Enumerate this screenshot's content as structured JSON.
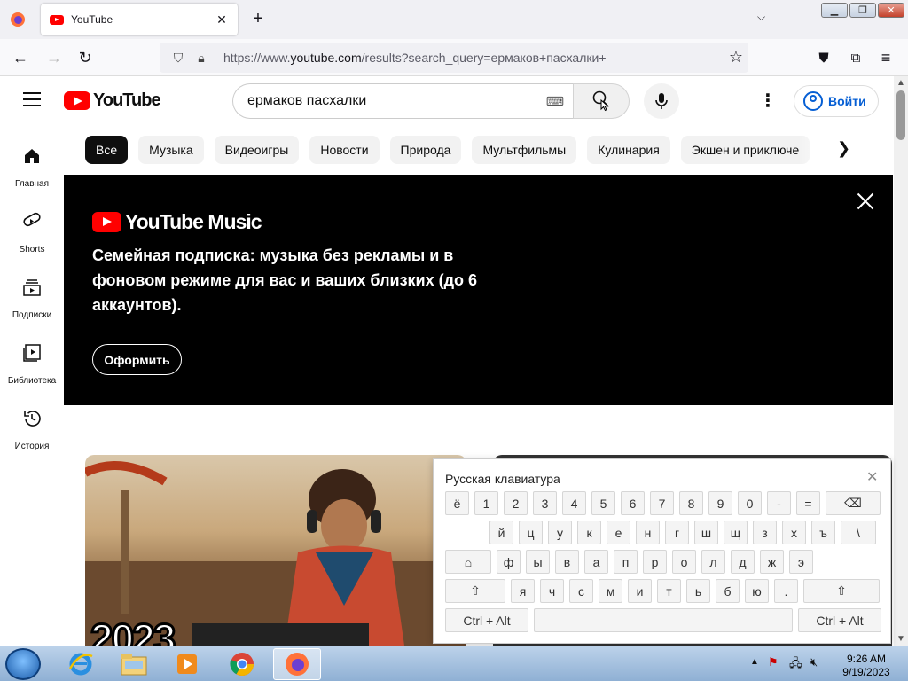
{
  "browser": {
    "tab_title": "YouTube",
    "new_tab": "+",
    "url_host": "https://www.",
    "url_domain": "youtube.com",
    "url_path": "/results?search_query=ермаков+пасхалки+"
  },
  "youtube": {
    "logo_text": "YouTube",
    "search_value": "ермаков пасхалки",
    "signin_label": "Войти",
    "chips": [
      "Все",
      "Музыка",
      "Видеоигры",
      "Новости",
      "Природа",
      "Мультфильмы",
      "Кулинария",
      "Экшен и приключе"
    ],
    "sidebar": [
      {
        "label": "Главная",
        "icon": "home-icon"
      },
      {
        "label": "Shorts",
        "icon": "shorts-icon"
      },
      {
        "label": "Подписки",
        "icon": "subscriptions-icon"
      },
      {
        "label": "Библиотека",
        "icon": "library-icon"
      },
      {
        "label": "История",
        "icon": "history-icon"
      }
    ],
    "banner": {
      "logo_text": "YouTube Music",
      "text": "Семейная подписка: музыка без рекламы и в фоновом режиме для вас и ваших близких (до 6 аккаунтов).",
      "button": "Оформить"
    },
    "thumbnail_text": "2023"
  },
  "keyboard": {
    "title": "Русская клавиатура",
    "row1": [
      "ё",
      "1",
      "2",
      "3",
      "4",
      "5",
      "6",
      "7",
      "8",
      "9",
      "0",
      "-",
      "="
    ],
    "row2": [
      "й",
      "ц",
      "у",
      "к",
      "е",
      "н",
      "г",
      "ш",
      "щ",
      "з",
      "х",
      "ъ",
      "\\"
    ],
    "row3": [
      "ф",
      "ы",
      "в",
      "а",
      "п",
      "р",
      "о",
      "л",
      "д",
      "ж",
      "э"
    ],
    "row4": [
      "я",
      "ч",
      "с",
      "м",
      "и",
      "т",
      "ь",
      "б",
      "ю",
      "."
    ],
    "ctrl_alt": "Ctrl + Alt"
  },
  "taskbar": {
    "time": "9:26 AM",
    "date": "9/19/2023"
  }
}
